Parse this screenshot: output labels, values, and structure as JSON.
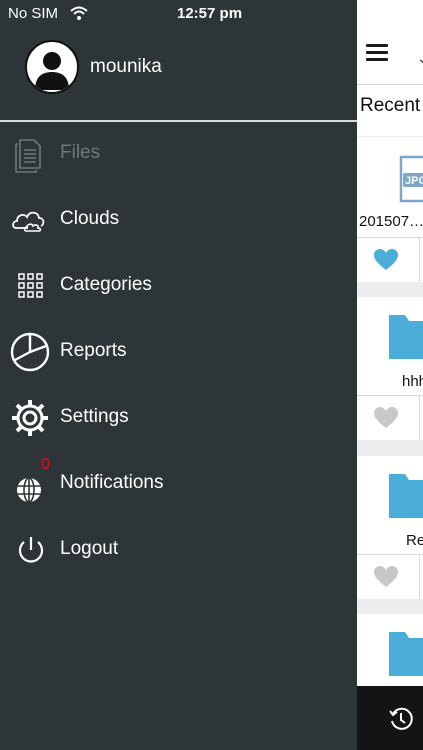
{
  "status_bar": {
    "carrier": "No SIM",
    "time": "12:57 pm",
    "wifi_icon": "wifi-icon",
    "battery_icon": "battery-icon"
  },
  "profile": {
    "username": "mounika",
    "avatar_icon": "user-avatar-icon"
  },
  "menu": [
    {
      "label": "Files",
      "icon": "files-icon",
      "disabled": true
    },
    {
      "label": "Clouds",
      "icon": "cloud-icon"
    },
    {
      "label": "Categories",
      "icon": "grid-icon"
    },
    {
      "label": "Reports",
      "icon": "pie-chart-icon"
    },
    {
      "label": "Settings",
      "icon": "gear-icon"
    },
    {
      "label": "Notifications",
      "icon": "globe-icon",
      "badge": "0"
    },
    {
      "label": "Logout",
      "icon": "power-icon"
    }
  ],
  "content": {
    "menu_icon": "hamburger-icon",
    "dropdown_icon": "chevron-down-icon",
    "section_title": "Recent",
    "items": [
      {
        "name": "201507…",
        "type": "jpg",
        "favorite": true
      },
      {
        "name": "hhh",
        "type": "folder",
        "favorite": false
      },
      {
        "name": "Re",
        "type": "folder",
        "favorite": false
      },
      {
        "name": "",
        "type": "folder",
        "favorite": false
      }
    ],
    "bottom_icon": "history-icon"
  },
  "colors": {
    "drawer_bg": "#2e3538",
    "accent_blue": "#4aaed8",
    "badge_red": "#e01010",
    "favorite_blue": "#4aaed8",
    "heart_gray": "#c8c8c8"
  }
}
